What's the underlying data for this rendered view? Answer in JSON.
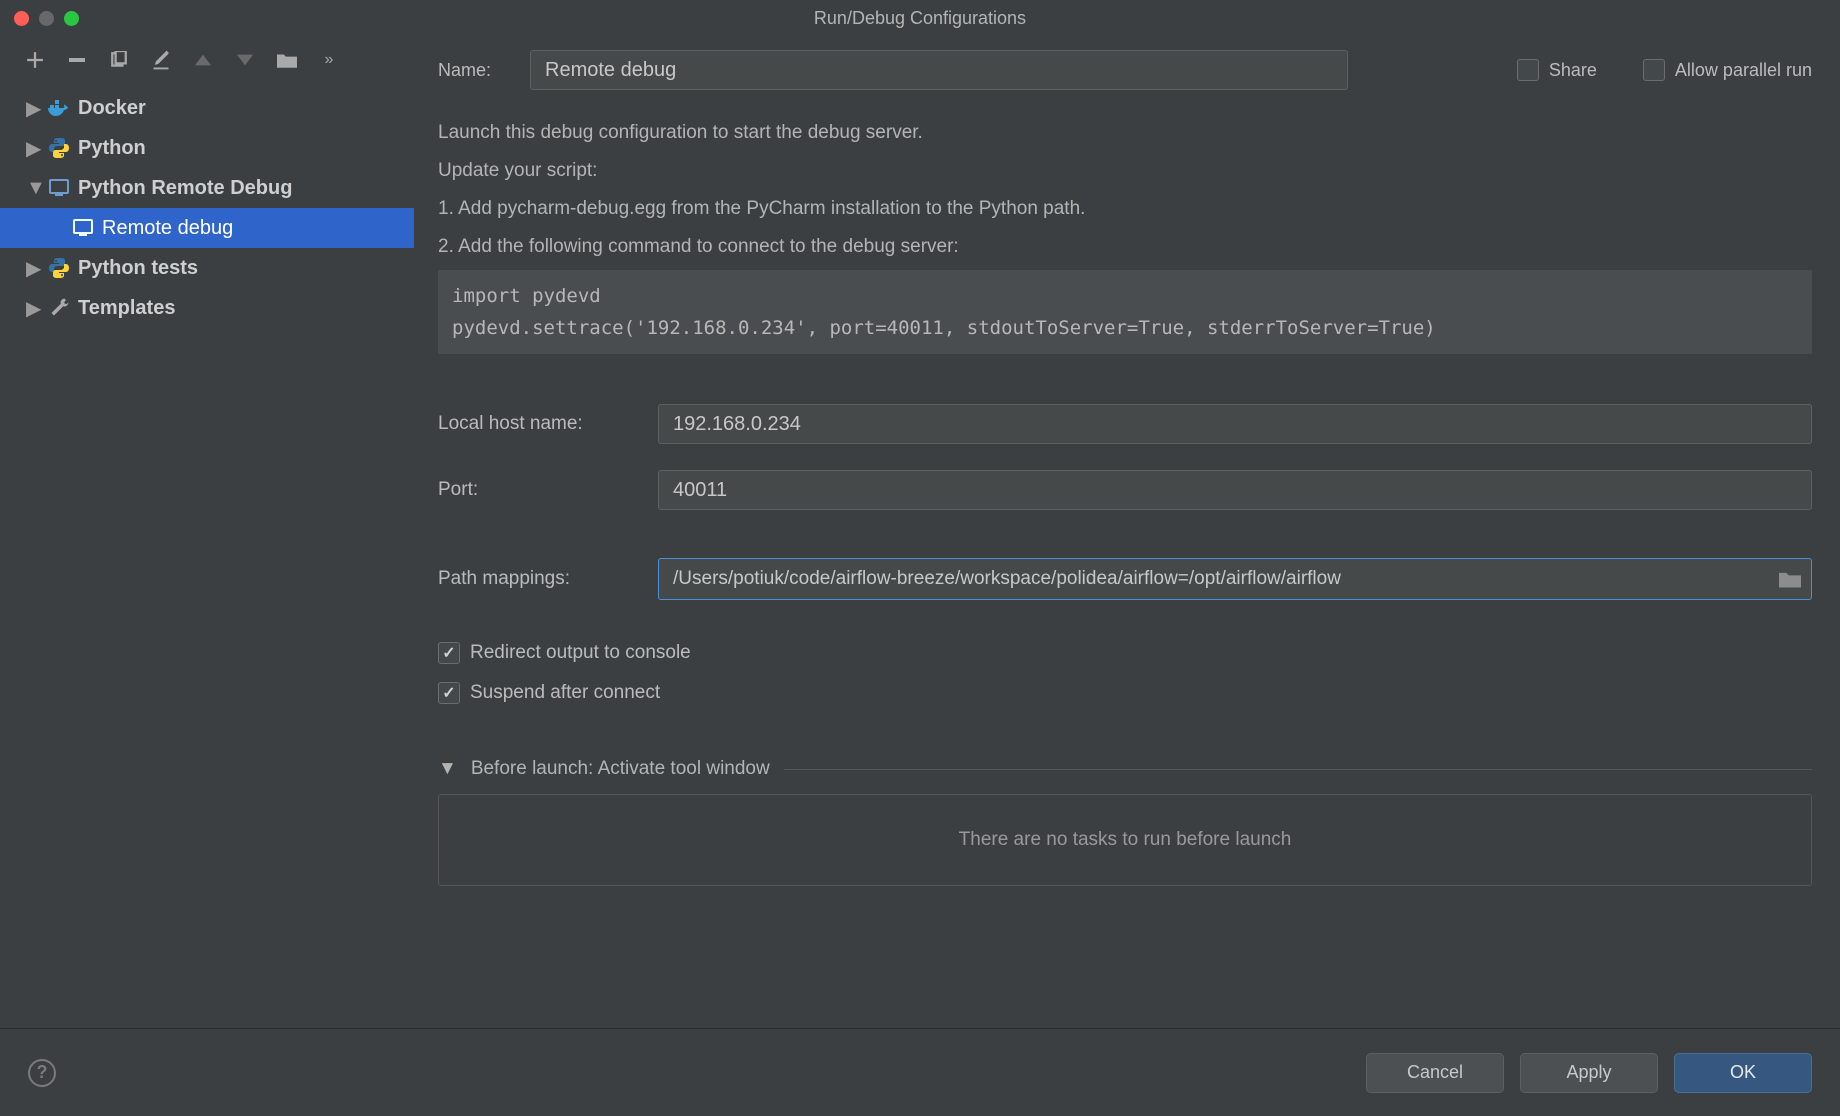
{
  "window": {
    "title": "Run/Debug Configurations"
  },
  "sidebar": {
    "tree": [
      {
        "label": "Docker",
        "expanded": false,
        "icon": "docker"
      },
      {
        "label": "Python",
        "expanded": false,
        "icon": "python"
      },
      {
        "label": "Python Remote Debug",
        "expanded": true,
        "icon": "remote",
        "children": [
          {
            "label": "Remote debug",
            "selected": true,
            "icon": "remote"
          }
        ]
      },
      {
        "label": "Python tests",
        "expanded": false,
        "icon": "python"
      },
      {
        "label": "Templates",
        "expanded": false,
        "icon": "wrench"
      }
    ]
  },
  "form": {
    "name_label": "Name:",
    "name_value": "Remote debug",
    "share_label": "Share",
    "share_checked": false,
    "parallel_label": "Allow parallel run",
    "parallel_checked": false,
    "instructions": {
      "l1": "Launch this debug configuration to start the debug server.",
      "l2": "Update your script:",
      "l3": "1. Add pycharm-debug.egg from the PyCharm installation to the Python path.",
      "l4": "2. Add the following command to connect to the debug server:"
    },
    "code": "import pydevd\npydevd.settrace('192.168.0.234', port=40011, stdoutToServer=True, stderrToServer=True)",
    "host_label": "Local host name:",
    "host_value": "192.168.0.234",
    "port_label": "Port:",
    "port_value": "40011",
    "path_label": "Path mappings:",
    "path_value": "/Users/potiuk/code/airflow-breeze/workspace/polidea/airflow=/opt/airflow/airflow",
    "redirect_label": "Redirect output to console",
    "redirect_checked": true,
    "suspend_label": "Suspend after connect",
    "suspend_checked": true,
    "before_launch_title": "Before launch: Activate tool window",
    "before_launch_empty": "There are no tasks to run before launch"
  },
  "footer": {
    "cancel": "Cancel",
    "apply": "Apply",
    "ok": "OK"
  }
}
